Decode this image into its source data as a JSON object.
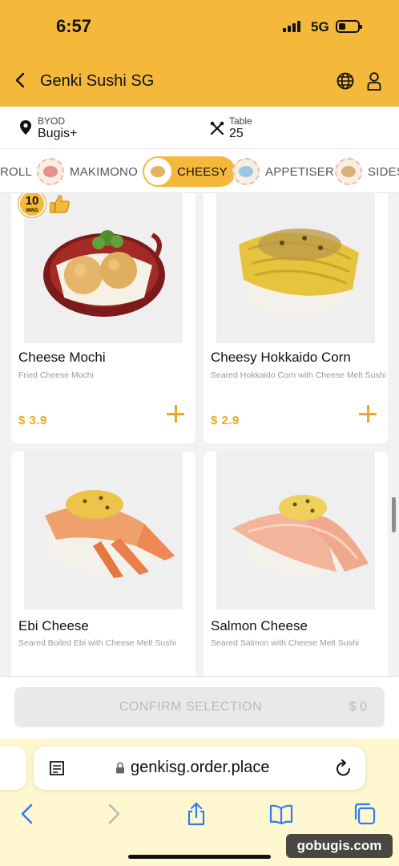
{
  "status_bar": {
    "time": "6:57",
    "network": "5G",
    "battery_level": 0.3
  },
  "header": {
    "title": "Genki Sushi SG",
    "back_icon": "chevron-left-icon",
    "globe_icon": "globe-icon",
    "user_icon": "user-icon"
  },
  "info": {
    "location_label": "BYOD",
    "location_value": "Bugis+",
    "table_label": "Table",
    "table_value": "25"
  },
  "categories": [
    {
      "label": "ROLL",
      "active": false
    },
    {
      "label": "MAKIMONO",
      "active": false
    },
    {
      "label": "CHEESY",
      "active": true
    },
    {
      "label": "APPETISER",
      "active": false
    },
    {
      "label": "SIDES",
      "active": false
    }
  ],
  "menu_items": [
    {
      "name": "Cheese Mochi",
      "description": "Fried Cheese Mochi",
      "price": "$ 3.9",
      "badge_number": "10",
      "badge_unit": "MINS"
    },
    {
      "name": "Cheesy Hokkaido Corn",
      "description": "Seared Hokkaido Corn with Cheese Melt Sushi",
      "price": "$ 2.9"
    },
    {
      "name": "Ebi Cheese",
      "description": "Seared Boiled Ebi with Cheese Melt Sushi"
    },
    {
      "name": "Salmon Cheese",
      "description": "Seared Salmon with Cheese Melt Sushi"
    }
  ],
  "footer": {
    "confirm_label": "CONFIRM SELECTION",
    "total": "$ 0"
  },
  "browser": {
    "url": "genkisg.order.place"
  },
  "watermark": "gobugis.com",
  "colors": {
    "brand_yellow": "#f4b93b",
    "price_orange": "#e9a923"
  }
}
